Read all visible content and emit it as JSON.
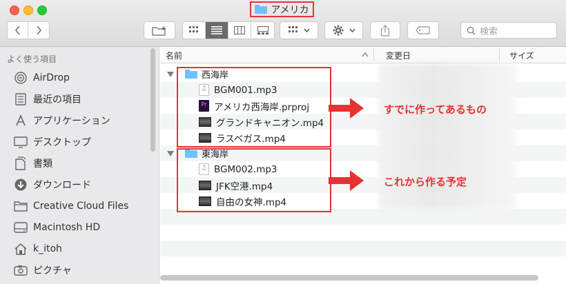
{
  "window": {
    "title": "アメリカ"
  },
  "toolbar": {
    "search_placeholder": "検索"
  },
  "sidebar": {
    "heading": "よく使う項目",
    "items": [
      {
        "label": "AirDrop",
        "icon": "airdrop-icon"
      },
      {
        "label": "最近の項目",
        "icon": "recents-icon"
      },
      {
        "label": "アプリケーション",
        "icon": "applications-icon"
      },
      {
        "label": "デスクトップ",
        "icon": "desktop-icon"
      },
      {
        "label": "書類",
        "icon": "documents-icon"
      },
      {
        "label": "ダウンロード",
        "icon": "downloads-icon"
      },
      {
        "label": "Creative Cloud Files",
        "icon": "folder-icon"
      },
      {
        "label": "Macintosh HD",
        "icon": "disk-icon"
      },
      {
        "label": "k_itoh",
        "icon": "home-icon"
      },
      {
        "label": "ピクチャ",
        "icon": "pictures-icon"
      }
    ]
  },
  "columns": {
    "name": "名前",
    "modified": "変更日",
    "size": "サイズ"
  },
  "groups": [
    {
      "name": "西海岸",
      "files": [
        {
          "name": "BGM001.mp3",
          "type": "audio"
        },
        {
          "name": "アメリカ西海岸.prproj",
          "type": "premiere"
        },
        {
          "name": "グランドキャニオン.mp4",
          "type": "video"
        },
        {
          "name": "ラスベガス.mp4",
          "type": "video"
        }
      ]
    },
    {
      "name": "東海岸",
      "files": [
        {
          "name": "BGM002.mp3",
          "type": "audio"
        },
        {
          "name": "JFK空港.mp4",
          "type": "video"
        },
        {
          "name": "自由の女神.mp4",
          "type": "video"
        }
      ]
    }
  ],
  "annotations": {
    "existing": "すでに作ってあるもの",
    "planned": "これから作る予定"
  },
  "colors": {
    "highlight": "#e53232",
    "folder": "#6fc2fb"
  }
}
